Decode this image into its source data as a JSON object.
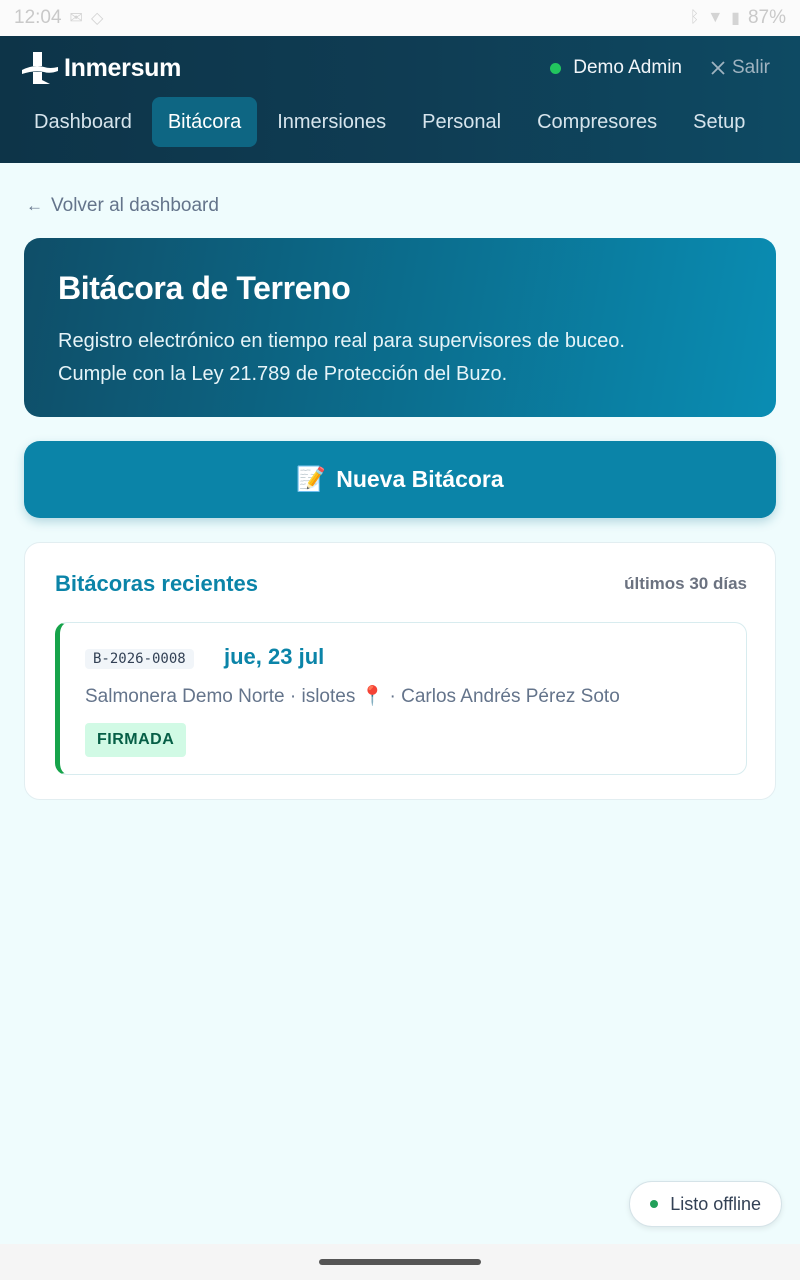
{
  "statusbar": {
    "time": "12:04",
    "icons_left": [
      "mail-icon",
      "notification-icon"
    ],
    "icons_right": [
      "bluetooth-icon",
      "wifi-icon",
      "battery-icon"
    ],
    "battery": "87%"
  },
  "header": {
    "brand": "Inmersum",
    "user_name": "Demo Admin",
    "user_status_color": "#22c55e",
    "logout_label": "Salir",
    "tabs": [
      {
        "label": "Dashboard",
        "active": false
      },
      {
        "label": "Bitácora",
        "active": true
      },
      {
        "label": "Inmersiones",
        "active": false
      },
      {
        "label": "Personal",
        "active": false
      },
      {
        "label": "Compresores",
        "active": false
      },
      {
        "label": "Setup",
        "active": false
      }
    ]
  },
  "main": {
    "back_label": "Volver al dashboard",
    "hero": {
      "title": "Bitácora de Terreno",
      "description_line1": "Registro electrónico en tiempo real para supervisores de buceo.",
      "description_line2": "Cumple con la Ley 21.789 de Protección del Buzo."
    },
    "new_button": {
      "icon": "📝",
      "label": "Nueva Bitácora"
    },
    "recent": {
      "title": "Bitácoras recientes",
      "subtitle": "últimos 30 días",
      "entries": [
        {
          "code": "B-2026-0008",
          "date": "jue, 23 jul",
          "meta": "Salmonera Demo Norte · islotes 📍 · Carlos Andrés Pérez Soto",
          "status": "FIRMADA",
          "status_color": "#16a34a"
        }
      ]
    }
  },
  "offline_indicator": {
    "label": "Listo offline",
    "dot_color": "#22a05a"
  },
  "colors": {
    "accent": "#0b84a8",
    "header_bg": "#0f3c53",
    "page_bg": "#effcfd"
  }
}
